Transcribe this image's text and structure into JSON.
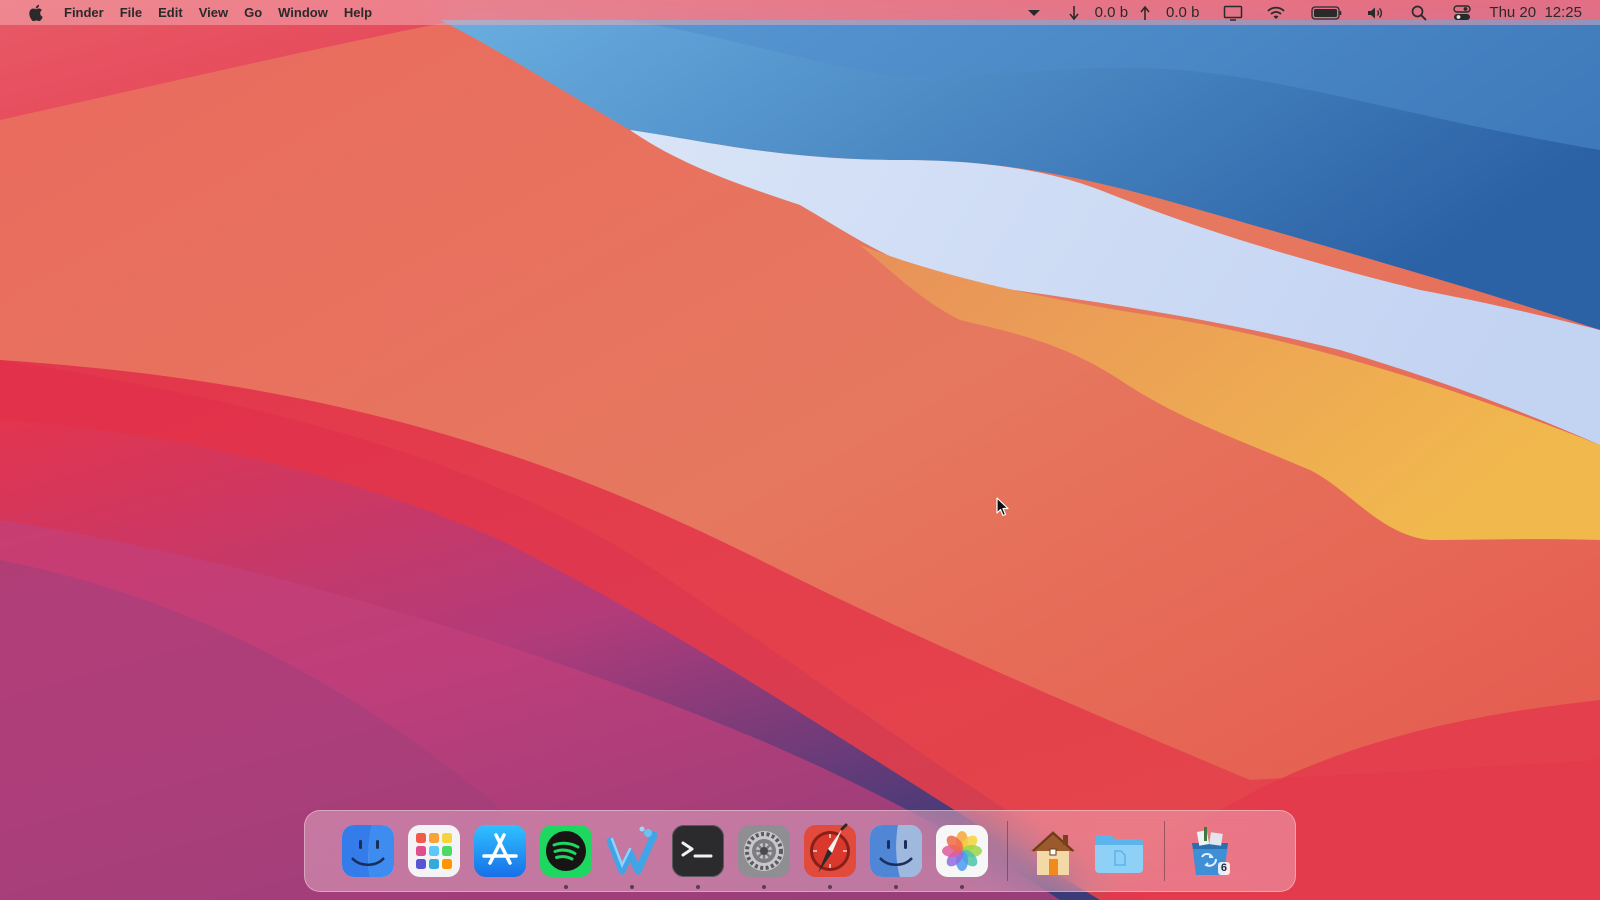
{
  "menubar": {
    "app_name": "Finder",
    "menus": [
      "File",
      "Edit",
      "View",
      "Go",
      "Window",
      "Help"
    ],
    "network": {
      "download_rate": "0.0 b",
      "upload_rate": "0.0 b"
    },
    "clock": "Thu 20  12:25",
    "status_icons": [
      "dropdown-icon",
      "download-arrow-icon",
      "upload-arrow-icon",
      "display-icon",
      "wifi-icon",
      "battery-icon",
      "volume-icon",
      "spotlight-search-icon",
      "control-center-icon"
    ]
  },
  "dock": {
    "apps": [
      {
        "icon": "finder-icon",
        "running": false
      },
      {
        "icon": "launchpad-icon",
        "running": false
      },
      {
        "icon": "app-store-icon",
        "running": false
      },
      {
        "icon": "spotify-icon",
        "running": true
      },
      {
        "icon": "waterfox-icon",
        "running": true
      },
      {
        "icon": "terminal-icon",
        "running": true
      },
      {
        "icon": "system-preferences-icon",
        "running": true
      },
      {
        "icon": "web-browser-icon",
        "running": true
      },
      {
        "icon": "finder-icon",
        "running": true
      },
      {
        "icon": "photos-icon",
        "running": true
      }
    ],
    "folders": [
      {
        "icon": "home-folder-icon"
      },
      {
        "icon": "documents-folder-icon"
      }
    ],
    "trash": {
      "icon": "trash-icon",
      "badge": "6"
    }
  },
  "colors": {
    "menubar_text": "#2a2a2a",
    "wallpaper_red": "#e8344a",
    "wallpaper_coral": "#e7705e",
    "wallpaper_blue": "#3f7fc0",
    "wallpaper_orange": "#eda84a",
    "wallpaper_purple": "#6a3a78"
  }
}
